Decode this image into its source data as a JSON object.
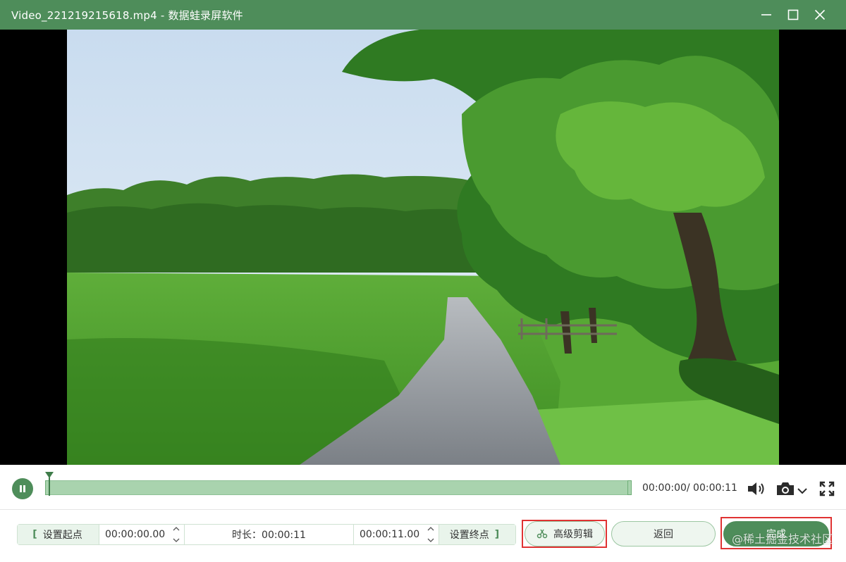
{
  "window": {
    "title": "Video_221219215618.mp4  -  数据蛙录屏软件"
  },
  "playback": {
    "current_time": "00:00:00",
    "total_time": "00:00:11",
    "time_display": "00:00:00/ 00:00:11"
  },
  "trim": {
    "set_start_label": "设置起点",
    "start_value": "00:00:00.00",
    "duration_label": "时长：00:00:11",
    "end_value": "00:00:11.00",
    "set_end_label": "设置终点"
  },
  "actions": {
    "advanced_edit_label": "高级剪辑",
    "back_label": "返回",
    "done_label": "完成"
  },
  "watermark": "@稀土掘金技术社区",
  "colors": {
    "accent": "#4e8d5a",
    "highlight_box": "#e03333"
  }
}
